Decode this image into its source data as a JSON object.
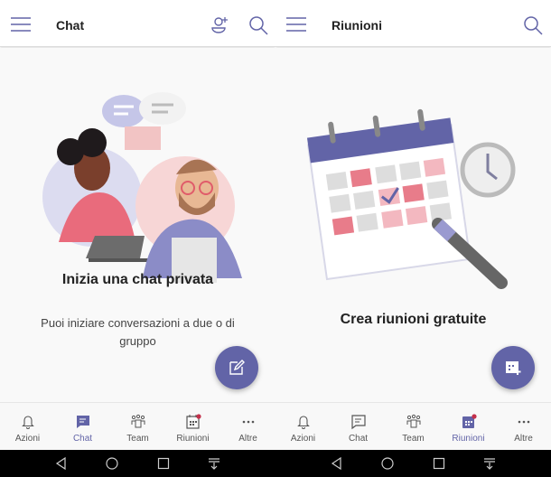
{
  "colors": {
    "accent": "#6264a7",
    "badge": "#c4314b"
  },
  "left": {
    "header": {
      "title": "Chat",
      "icons": [
        "hamburger-icon",
        "add-person-icon",
        "search-icon"
      ]
    },
    "empty": {
      "heading": "Inizia una chat privata",
      "subtitle": "Puoi iniziare conversazioni a due o di gruppo"
    },
    "fab_icon": "compose-icon",
    "tabs": [
      {
        "label": "Azioni",
        "icon": "bell-icon"
      },
      {
        "label": "Chat",
        "icon": "chat-icon",
        "active": true
      },
      {
        "label": "Team",
        "icon": "team-icon"
      },
      {
        "label": "Riunioni",
        "icon": "calendar-icon",
        "badge": true
      },
      {
        "label": "Altre",
        "icon": "more-icon"
      }
    ]
  },
  "right": {
    "header": {
      "title": "Riunioni",
      "icons": [
        "hamburger-icon",
        "search-icon"
      ]
    },
    "empty": {
      "heading": "Crea riunioni gratuite"
    },
    "fab_icon": "calendar-add-icon",
    "tabs": [
      {
        "label": "Azioni",
        "icon": "bell-icon"
      },
      {
        "label": "Chat",
        "icon": "chat-icon"
      },
      {
        "label": "Team",
        "icon": "team-icon"
      },
      {
        "label": "Riunioni",
        "icon": "calendar-icon",
        "badge": true,
        "active": true
      },
      {
        "label": "Altre",
        "icon": "more-icon"
      }
    ]
  },
  "nav": [
    "back-icon",
    "home-icon",
    "recents-icon",
    "notification-pull-icon"
  ]
}
